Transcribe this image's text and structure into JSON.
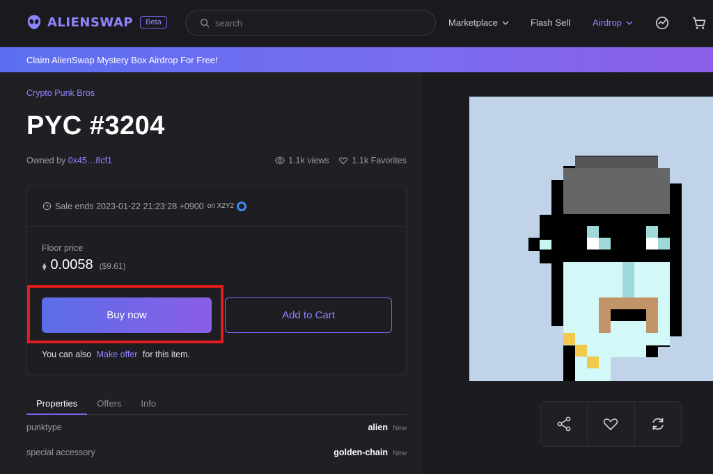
{
  "header": {
    "logo_text": "ALIENSWAP",
    "beta_label": "Beta",
    "search_placeholder": "search",
    "nav": {
      "marketplace": "Marketplace",
      "flash_sell": "Flash Sell",
      "airdrop": "Airdrop"
    },
    "icons": [
      "chart-icon",
      "cart-icon"
    ],
    "accent_color": "#8f84ff"
  },
  "banner": {
    "text": "Claim AlienSwap Mystery Box Airdrop For Free!"
  },
  "item": {
    "collection": "Crypto Punk Bros",
    "title": "PYC #3204",
    "owned_by_label": "Owned by",
    "owner": "0x45…8cf1",
    "views": "1.1k views",
    "favorites": "1.1k Favorites"
  },
  "sale": {
    "ends_text": "Sale ends 2023-01-22 21:23:28 +0900",
    "on_label": "on X2Y2",
    "floor_label": "Floor price",
    "eth_symbol": "⧫",
    "floor_value": "0.0058",
    "floor_usd": "($9.61)",
    "buy_label": "Buy now",
    "cart_label": "Add to Cart",
    "also_prefix": "You can also",
    "make_offer": "Make offer",
    "also_suffix": "for this item."
  },
  "tabs": [
    {
      "label": "Properties",
      "active": true
    },
    {
      "label": "Offers",
      "active": false
    },
    {
      "label": "Info",
      "active": false
    }
  ],
  "properties": [
    {
      "key": "punktype",
      "value": "alien",
      "badge": "New"
    },
    {
      "key": "special accessory",
      "value": "golden-chain",
      "badge": "New"
    }
  ],
  "actions": [
    "share-icon",
    "heart-icon",
    "refresh-icon"
  ]
}
